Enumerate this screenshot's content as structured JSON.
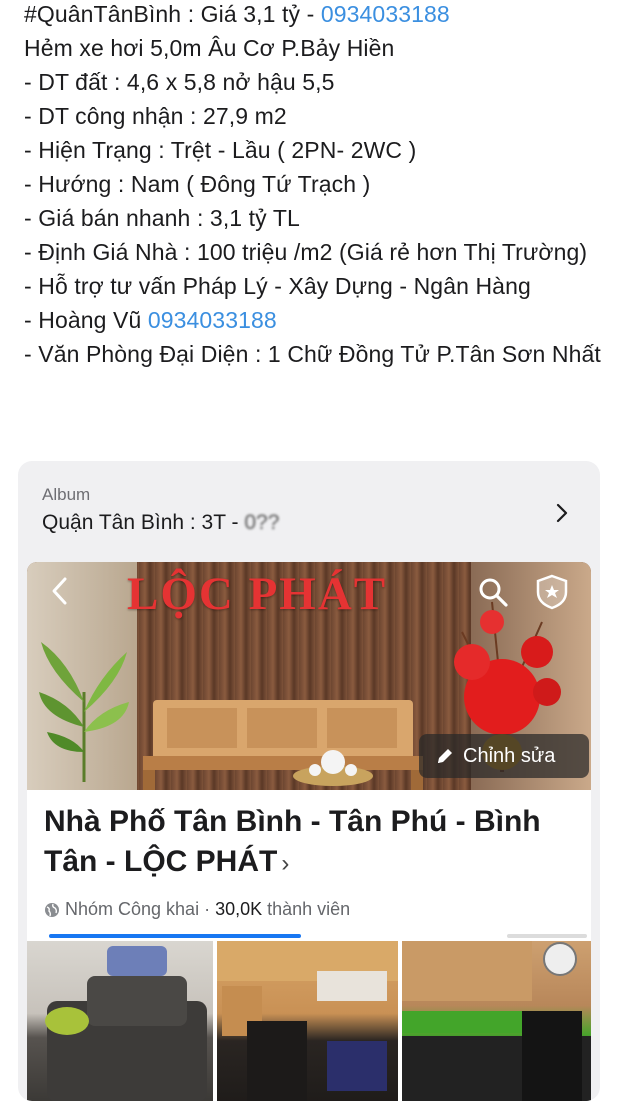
{
  "post": {
    "lines": [
      {
        "text": "#QuânTânBình : Giá 3,1 tỷ - ",
        "phone": "0934033188"
      },
      {
        "text": "Hẻm xe hơi 5,0m Âu Cơ P.Bảy Hiền"
      },
      {
        "text": "- DT đất : 4,6 x 5,8 nở hậu 5,5"
      },
      {
        "text": "- DT công nhận : 27,9 m2"
      },
      {
        "text": "- Hiện Trạng : Trệt - Lầu ( 2PN- 2WC )"
      },
      {
        "text": "- Hướng : Nam ( Đông Tứ Trạch )"
      },
      {
        "text": "- Giá bán nhanh : 3,1 tỷ TL"
      },
      {
        "text": "- Định Giá Nhà : 100 triệu /m2 (Giá rẻ hơn Thị Trường)"
      },
      {
        "text": "- Hỗ trợ tư vấn Pháp Lý - Xây Dựng - Ngân Hàng"
      },
      {
        "text": "- Hoàng Vũ ",
        "phone": "0934033188"
      },
      {
        "text": "- Văn Phòng Đại Diện : 1 Chữ Đồng Tử P.Tân Sơn Nhất"
      }
    ]
  },
  "album": {
    "label": "Album",
    "title": "Quận Tân Bình : 3T - ",
    "title_obscured": "0??"
  },
  "group": {
    "cover_sign": "LỘC PHÁT",
    "edit_label": "Chỉnh sửa",
    "name": "Nhà Phố Tân Bình - Tân Phú - Bình Tân - LỘC PHÁT",
    "chevron": "›",
    "privacy": "Nhóm Công khai",
    "separator": " · ",
    "members_count": "30,0K",
    "members_label": " thành viên"
  },
  "colors": {
    "link": "#3b8fe0",
    "card_bg": "#f0f0f2",
    "fb_blue": "#1877f2",
    "sign_red": "#e53333"
  },
  "icons": [
    "chevron-right-icon",
    "back-arrow-icon",
    "search-icon",
    "shield-icon",
    "pencil-icon",
    "globe-icon"
  ]
}
